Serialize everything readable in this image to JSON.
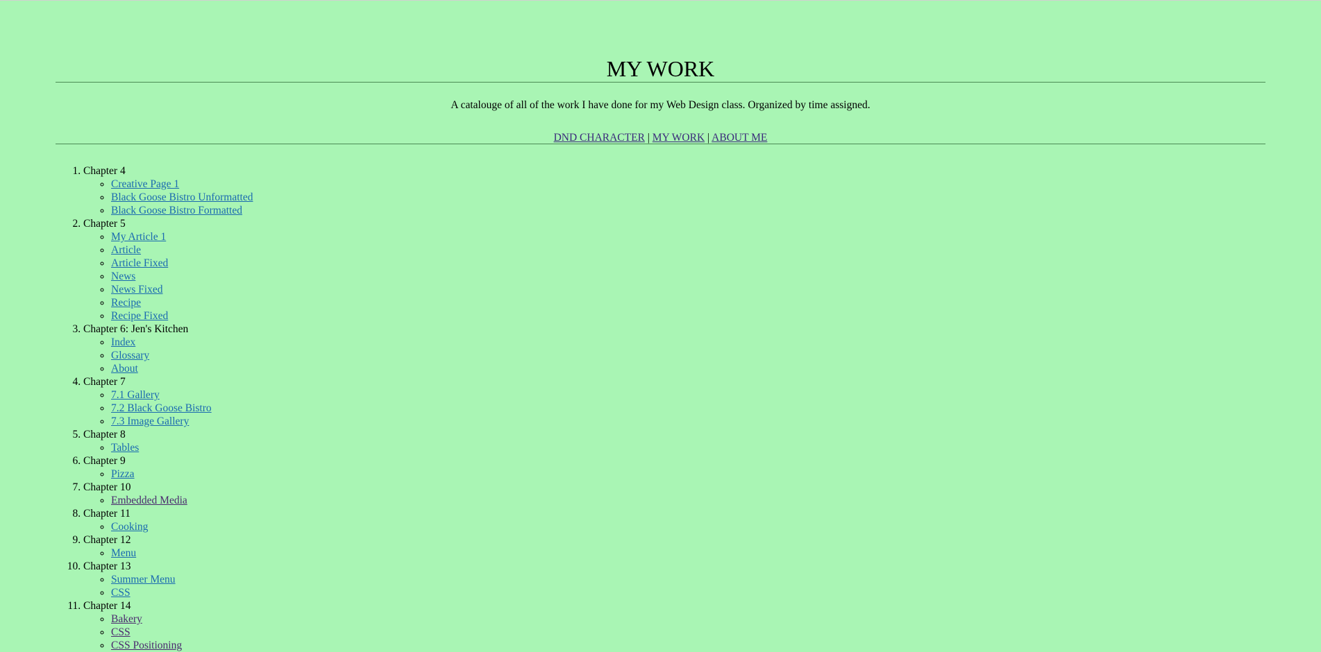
{
  "header": {
    "title": "MY WORK",
    "subtitle": "A catalouge of all of the work I have done for my Web Design class. Organized by time assigned."
  },
  "nav": {
    "items": [
      "DND CHARACTER",
      "MY WORK",
      "ABOUT ME"
    ],
    "separator": "|"
  },
  "chapters": [
    {
      "title": "Chapter 4",
      "links": [
        "Creative Page 1",
        "Black Goose Bistro Unformatted",
        "Black Goose Bistro Formatted"
      ]
    },
    {
      "title": "Chapter 5",
      "links": [
        "My Article 1",
        "Article",
        "Article Fixed",
        "News",
        "News Fixed",
        "Recipe",
        "Recipe Fixed"
      ]
    },
    {
      "title": "Chapter 6: Jen's Kitchen",
      "links": [
        "Index",
        "Glossary",
        "About"
      ]
    },
    {
      "title": "Chapter 7",
      "links": [
        "7.1 Gallery",
        "7.2 Black Goose Bistro",
        "7.3 Image Gallery"
      ]
    },
    {
      "title": "Chapter 8",
      "links": [
        "Tables"
      ]
    },
    {
      "title": "Chapter 9",
      "links": [
        "Pizza"
      ]
    },
    {
      "title": "Chapter 10",
      "links": [
        "Embedded Media"
      ]
    },
    {
      "title": "Chapter 11",
      "links": [
        "Cooking"
      ]
    },
    {
      "title": "Chapter 12",
      "links": [
        "Menu"
      ]
    },
    {
      "title": "Chapter 13",
      "links": [
        "Summer Menu",
        "CSS"
      ]
    },
    {
      "title": "Chapter 14",
      "links": [
        "Bakery",
        "CSS",
        "CSS Positioning"
      ]
    }
  ],
  "colors": {
    "background": "#a9f5b4",
    "link": "#1a6ab0",
    "visited_link": "#4a2a6e",
    "rule": "#4b8a55"
  }
}
